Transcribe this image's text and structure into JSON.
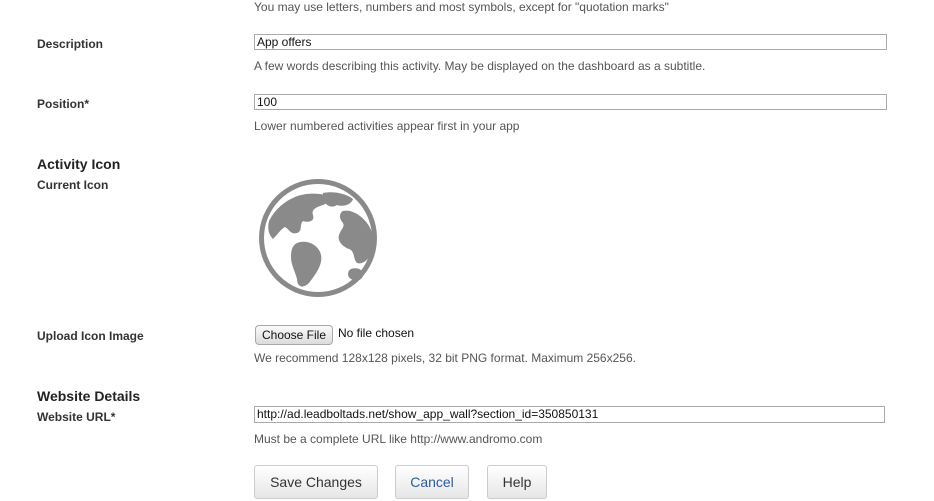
{
  "top_hint": "You may use letters, numbers and most symbols, except for \"quotation marks\"",
  "description": {
    "label": "Description",
    "value": "App offers",
    "help": "A few words describing this activity. May be displayed on the dashboard as a subtitle."
  },
  "position": {
    "label": "Position*",
    "value": "100",
    "help": "Lower numbered activities appear first in your app"
  },
  "activity_icon": {
    "section_title": "Activity Icon",
    "current_label": "Current Icon",
    "icon": "globe-icon",
    "icon_color": "#8a8a8a"
  },
  "upload": {
    "label": "Upload Icon Image",
    "button": "Choose File",
    "status": "No file chosen",
    "help": "We recommend 128x128 pixels, 32 bit PNG format. Maximum 256x256."
  },
  "website": {
    "section_title": "Website Details",
    "url_label": "Website URL*",
    "url_value": "http://ad.leadboltads.net/show_app_wall?section_id=350850131",
    "help": "Must be a complete URL like http://www.andromo.com"
  },
  "buttons": {
    "save": "Save Changes",
    "cancel": "Cancel",
    "help": "Help"
  },
  "colors": {
    "link": "#2a5d9f",
    "border": "#aaaaaa"
  }
}
